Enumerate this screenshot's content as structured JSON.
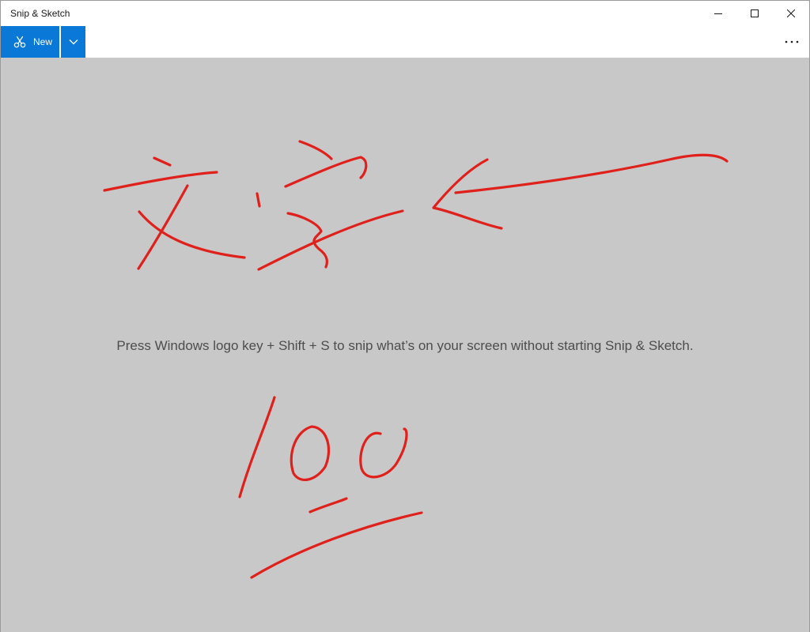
{
  "app": {
    "title": "Snip & Sketch"
  },
  "window_controls": {
    "minimize_icon": "minimize-icon",
    "maximize_icon": "maximize-icon",
    "close_icon": "close-icon"
  },
  "toolbar": {
    "new_label": "New",
    "new_icon": "snip-scissors-icon",
    "dropdown_icon": "chevron-down-icon",
    "more_icon": "more-options-icon"
  },
  "canvas": {
    "hint": "Press Windows logo key + Shift + S to snip what’s on your screen without starting Snip & Sketch.",
    "ink_color": "#e0201b",
    "background_color": "#c8c8c8"
  },
  "colors": {
    "accent": "#0a78d7"
  }
}
